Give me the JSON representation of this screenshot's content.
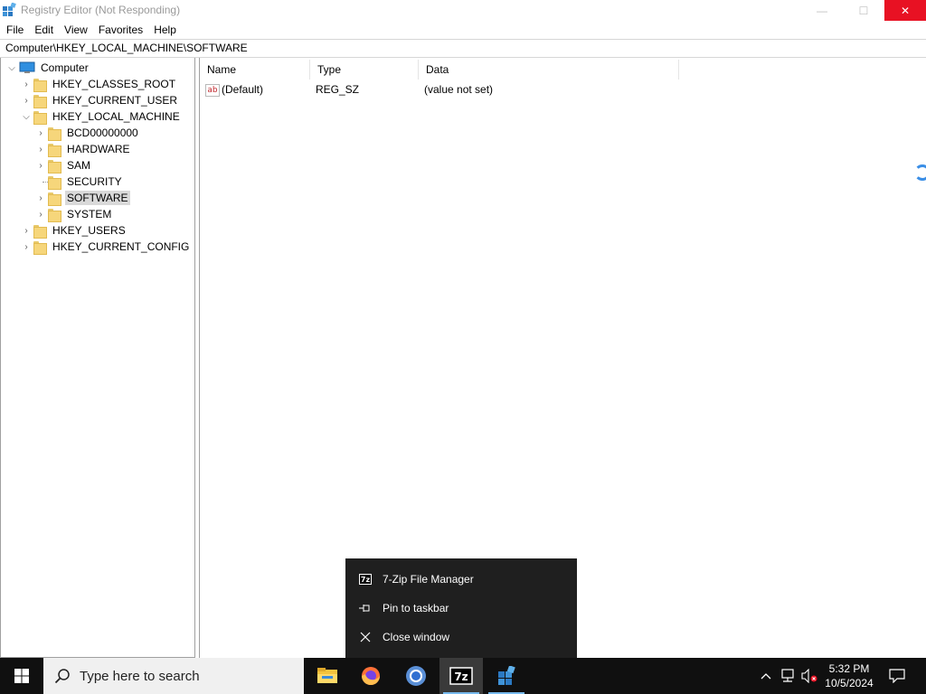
{
  "window": {
    "title": "Registry Editor (Not Responding)",
    "minimize_glyph": "—",
    "maximize_glyph": "☐",
    "close_glyph": "✕"
  },
  "menu": [
    "File",
    "Edit",
    "View",
    "Favorites",
    "Help"
  ],
  "address": "Computer\\HKEY_LOCAL_MACHINE\\SOFTWARE",
  "tree": [
    {
      "label": "Computer",
      "icon": "computer-icon",
      "expanded": true
    },
    {
      "label": "HKEY_CLASSES_ROOT",
      "icon": "folder-icon",
      "expanded": false
    },
    {
      "label": "HKEY_CURRENT_USER",
      "icon": "folder-icon",
      "expanded": false
    },
    {
      "label": "HKEY_LOCAL_MACHINE",
      "icon": "folder-icon",
      "expanded": true
    },
    {
      "label": "BCD00000000",
      "icon": "folder-icon",
      "expanded": false
    },
    {
      "label": "HARDWARE",
      "icon": "folder-icon",
      "expanded": false
    },
    {
      "label": "SAM",
      "icon": "folder-icon",
      "expanded": false
    },
    {
      "label": "SECURITY",
      "icon": "folder-icon",
      "expanded": false
    },
    {
      "label": "SOFTWARE",
      "icon": "folder-icon",
      "expanded": false,
      "selected": true
    },
    {
      "label": "SYSTEM",
      "icon": "folder-icon",
      "expanded": false
    },
    {
      "label": "HKEY_USERS",
      "icon": "folder-icon",
      "expanded": false
    },
    {
      "label": "HKEY_CURRENT_CONFIG",
      "icon": "folder-icon",
      "expanded": false
    }
  ],
  "columns": [
    "Name",
    "Type",
    "Data"
  ],
  "values": [
    {
      "icon_text": "ab",
      "name": "(Default)",
      "type": "REG_SZ",
      "data": "(value not set)"
    }
  ],
  "jumplist": {
    "items": [
      {
        "label": "7-Zip File Manager",
        "icon": "7zip-icon",
        "icon_text": "7z"
      },
      {
        "label": "Pin to taskbar",
        "icon": "pin-icon"
      },
      {
        "label": "Close window",
        "icon": "close-icon"
      }
    ]
  },
  "taskbar": {
    "search_placeholder": "Type here to search",
    "apps": [
      {
        "name": "file-explorer",
        "icon": "folder-icon"
      },
      {
        "name": "firefox",
        "icon": "firefox-icon"
      },
      {
        "name": "chrome",
        "icon": "chrome-icon"
      },
      {
        "name": "7zip",
        "icon": "7zip-icon",
        "icon_text": "7z"
      },
      {
        "name": "regedit",
        "icon": "regedit-icon"
      }
    ],
    "time": "5:32 PM",
    "date": "10/5/2024"
  },
  "colors": {
    "close_button": "#e81123",
    "selection": "#d9d9d9",
    "taskbar": "#101010",
    "jumplist": "#1f1f1f",
    "accent": "#76b9ed"
  }
}
